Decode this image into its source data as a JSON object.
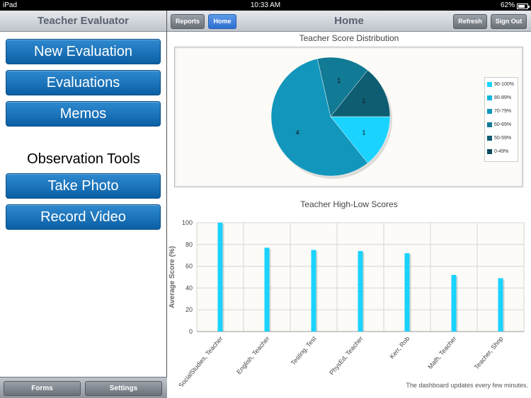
{
  "status_bar": {
    "device": "iPad",
    "time": "10:33 AM",
    "battery": "62%",
    "battery_level": 0.62
  },
  "sidebar": {
    "title": "Teacher Evaluator",
    "buttons": [
      "New Evaluation",
      "Evaluations",
      "Memos"
    ],
    "section_label": "Observation Tools",
    "tool_buttons": [
      "Take Photo",
      "Record Video"
    ],
    "footer_buttons": [
      "Forms",
      "Settings"
    ]
  },
  "toolbar": {
    "title": "Home",
    "reports_label": "Reports",
    "home_label": "Home",
    "refresh_label": "Refresh",
    "signout_label": "Sign Out"
  },
  "footnote": "The dashboard updates every few minutes.",
  "colors": {
    "accent": "#1a8fd8",
    "bar": "#1ad3ff"
  },
  "chart_data": [
    {
      "type": "pie",
      "title": "Teacher Score Distribution",
      "legend": [
        "90-100%",
        "80-89%",
        "70-79%",
        "60-69%",
        "50-59%",
        "0-49%"
      ],
      "legend_colors": [
        "#1ad3ff",
        "#15b6dc",
        "#1296bb",
        "#117a95",
        "#0e5d73",
        "#0c4a5b"
      ],
      "slices": [
        {
          "label": "90-100%",
          "value": 1,
          "color": "#1ad3ff"
        },
        {
          "label": "70-79%",
          "value": 4,
          "color": "#1296bb"
        },
        {
          "label": "60-69%",
          "value": 1,
          "color": "#117a95"
        },
        {
          "label": "50-59%",
          "value": 1,
          "color": "#0e5d73"
        }
      ],
      "legend_placement": "right"
    },
    {
      "type": "bar",
      "title": "Teacher High-Low Scores",
      "ylabel": "Average Score (%)",
      "xlabel": "",
      "ylim": [
        0,
        100
      ],
      "yticks": [
        "0",
        "20",
        "40",
        "60",
        "80",
        "100"
      ],
      "categories": [
        "SocialStudies, Teacher",
        "English, Teacher",
        "Testing, Test",
        "PhysEd, Teacher",
        "Kerr, Rob",
        "Math, Teacher",
        "Teacher, Shop"
      ],
      "values": [
        100,
        77,
        75,
        74,
        72,
        52,
        49
      ],
      "grid": true
    }
  ]
}
